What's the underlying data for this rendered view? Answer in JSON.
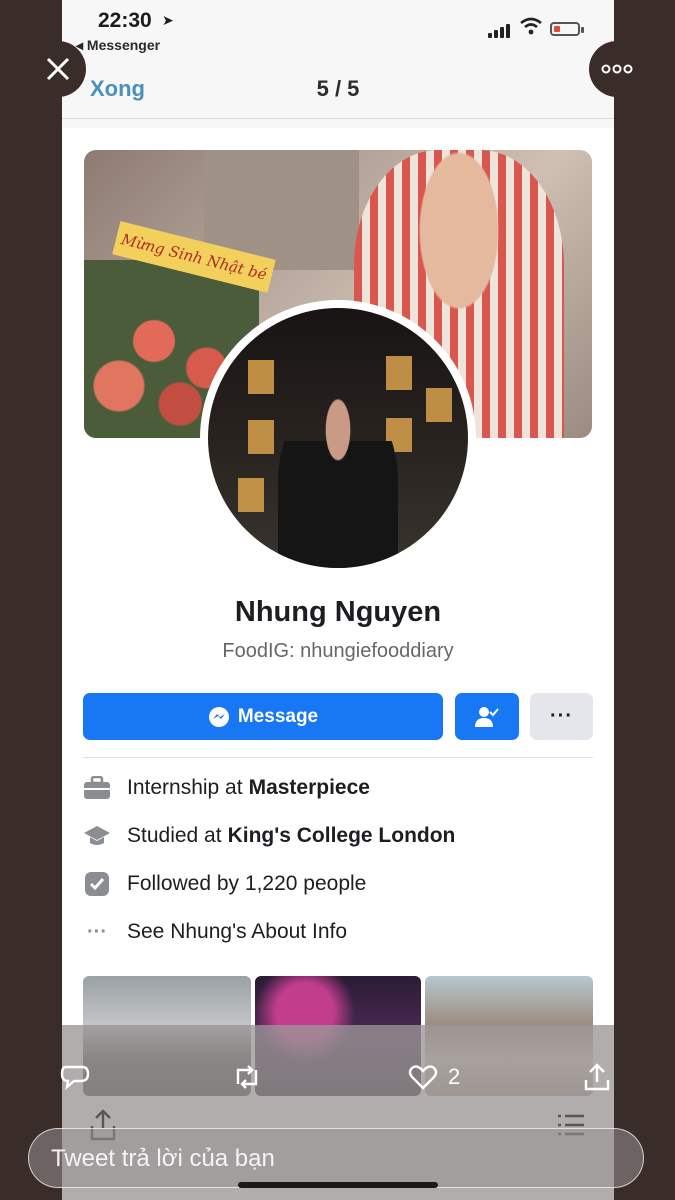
{
  "status_bar": {
    "time": "22:30",
    "back_app": "Messenger"
  },
  "nav": {
    "done_label": "Xong",
    "page_indicator": "5 / 5"
  },
  "cover": {
    "banner_text": "Mừng Sinh Nhật bé"
  },
  "profile": {
    "name": "Nhung Nguyen",
    "bio": "FoodIG: nhungiefooddiary",
    "message_label": "Message",
    "more_label": "···"
  },
  "intro": [
    {
      "icon": "briefcase-icon",
      "prefix": "Internship at",
      "bold": "Masterpiece"
    },
    {
      "icon": "graduation-cap-icon",
      "prefix": "Studied at",
      "bold": "King's College London"
    },
    {
      "icon": "followers-icon",
      "prefix": "Followed by 1,220 people",
      "bold": ""
    },
    {
      "icon": "ellipsis-icon",
      "prefix": "See Nhung's About Info",
      "bold": ""
    }
  ],
  "tweet": {
    "like_count": "2",
    "reply_placeholder": "Tweet trả lời của bạn"
  },
  "colors": {
    "facebook_blue": "#1877f2",
    "background": "#3a2c29",
    "done_link": "#4a90b8"
  }
}
